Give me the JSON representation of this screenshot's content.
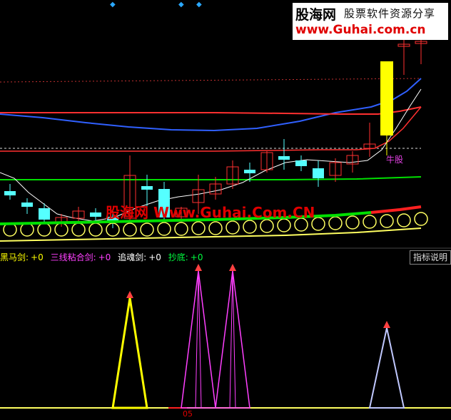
{
  "logo": {
    "brand": "股海网",
    "tagline": "股票软件资源分享",
    "url": "www.Guhai.com.cn"
  },
  "watermark": {
    "text": "股海网 Www.Guhai.Com.CN"
  },
  "annotation": {
    "niugu": "牛股"
  },
  "indicator_bar": {
    "items": [
      {
        "label": "黑马剑:",
        "value": "+0",
        "color": "#ffff00"
      },
      {
        "label": "三线粘合剑:",
        "value": "+0",
        "color": "#ff40ff"
      },
      {
        "label": "追魂剑:",
        "value": "+0",
        "color": "#ffffff"
      },
      {
        "label": "抄底:",
        "value": "+0",
        "color": "#00ff40"
      }
    ],
    "help_button": "指标说明"
  },
  "axis": {
    "tick_05": "05"
  },
  "colors": {
    "up_candle": "#ff3030",
    "down_candle": "#55ffff",
    "ma_blue": "#3060ff",
    "ma_red": "#ff3030",
    "ma_green": "#00e000",
    "ma_white": "#ffffff",
    "signal_yellow": "#ffff00",
    "signal_magenta": "#ff40ff",
    "signal_lavender": "#c0c8ff",
    "arrow_red": "#ff4040",
    "circle_yellow": "#ffff60"
  },
  "icons": [
    "diamond-marker-icon",
    "up-arrow-icon"
  ]
}
